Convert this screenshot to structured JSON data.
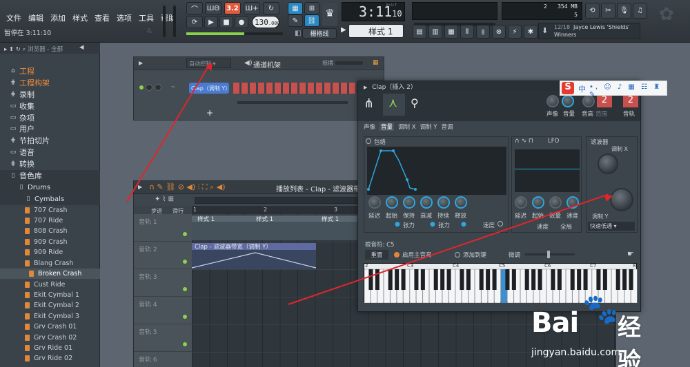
{
  "menu": [
    "文件",
    "编辑",
    "添加",
    "样式",
    "查看",
    "选项",
    "工具",
    "帮助"
  ],
  "hint": "暂停在 3:11:10",
  "transport": {
    "pat_label": "3.2",
    "w1": "Ш+",
    "w2": "Ш©",
    "tempo": "130",
    "tempo_dec": ".000",
    "time": "3:11",
    "time_sub": "10",
    "bst": "B:S:T",
    "pattern": "样式 1",
    "snap": "栅格线"
  },
  "cpu": {
    "ram": "354 MB",
    "num1": "2",
    "num2": "5"
  },
  "news": {
    "counter": "12/18",
    "line1": "Jayce Lewis 'Shields'",
    "line2": "Winners"
  },
  "browser": {
    "header": "浏览器 - 全部",
    "items": [
      {
        "label": "工程",
        "icon": "folder-open-icon",
        "orange": true
      },
      {
        "label": "工程构架",
        "icon": "tree-icon",
        "orange": true
      },
      {
        "label": "录制",
        "icon": "folder-icon"
      },
      {
        "label": "收集",
        "icon": "folder-icon"
      },
      {
        "label": "杂项",
        "icon": "folder-icon"
      },
      {
        "label": "用户",
        "icon": "folder-icon"
      },
      {
        "label": "节拍切片",
        "icon": "tree-icon"
      },
      {
        "label": "语音",
        "icon": "folder-icon"
      },
      {
        "label": "转换",
        "icon": "tree-icon"
      },
      {
        "label": "音色库",
        "icon": "folder-open-icon"
      },
      {
        "label": "Drums",
        "icon": "folder-open-icon"
      },
      {
        "label": "Cymbals",
        "icon": "folder-open-icon"
      }
    ],
    "files": [
      "707 Crash",
      "707 Ride",
      "808 Crash",
      "909 Crash",
      "909 Ride",
      "Blang Crash",
      "Broken Crash",
      "Cust Ride",
      "Ekit Cymbal 1",
      "Ekit Cymbal 2",
      "Ekit Cymbal 3",
      "Grv Crash 01",
      "Grv Crash 02",
      "Grv Ride 01",
      "Grv Ride 02"
    ]
  },
  "rack": {
    "auto": "自动控制",
    "title": "通道机架",
    "swing": "摇摆",
    "channel": "Clap（调制 Y）",
    "add": "+"
  },
  "playlist": {
    "title": "播放列表 - Clap - 滤波器带宽",
    "step": "步进",
    "slide": "滑行",
    "bars": [
      "1",
      "2",
      "3"
    ],
    "tracks": [
      "音轨 1",
      "音轨 2",
      "音轨 3",
      "音轨 4",
      "音轨 5",
      "音轨 6"
    ],
    "patterns": [
      "样式 1",
      "样式 1",
      "样式 1"
    ],
    "auto_clip": "Clap - 滤波器带宽（调制 Y）"
  },
  "plugin": {
    "title": "Clap（插入 2）",
    "top_labels": [
      "声像",
      "音量",
      "音高",
      "范围",
      "音轨"
    ],
    "pitch_val": "2",
    "track_val": "2",
    "tabs": [
      "声像",
      "音量",
      "调制 X",
      "调制 Y",
      "音调"
    ],
    "env_label": "包络",
    "env_knobs": [
      "延迟",
      "起始",
      "保持",
      "衰减",
      "持续",
      "释放"
    ],
    "tension": [
      "张力",
      "张力"
    ],
    "speed": "速度",
    "lfo_label": "LFO",
    "lfo_knobs": [
      "延迟",
      "起始",
      "数量",
      "速度"
    ],
    "tempo_lbl": "速度",
    "global_lbl": "全局",
    "filter_label": "滤波器",
    "mod_x": "调制 X",
    "mod_y": "调制 Y",
    "filter_type": "快速低通",
    "root_label": "根音符: C5",
    "reset": "重置",
    "enable_root": "启用主音高",
    "add_key": "添加到键",
    "fine": "微调",
    "octaves": [
      "2",
      "C3",
      "C4",
      "C5",
      "C6",
      "C7",
      "8"
    ]
  },
  "ime": {
    "label": "中"
  },
  "watermark": {
    "brand": "Bai",
    "brand2": "经验",
    "url": "jingyan.baidu.com"
  },
  "colors": {
    "accent": "#2fa6df",
    "orange": "#f08a3a",
    "arrow": "#e2252b",
    "led": "#8bd24a"
  }
}
